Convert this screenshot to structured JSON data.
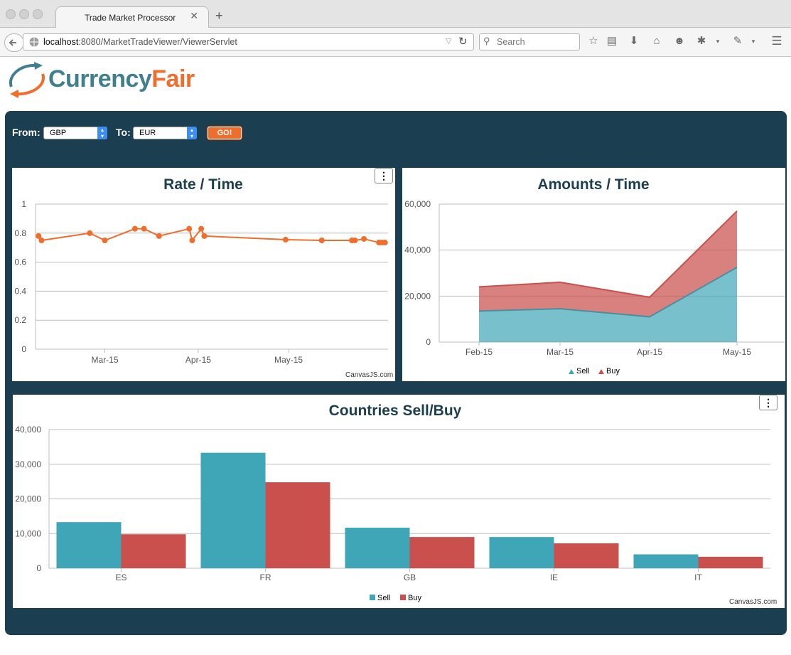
{
  "browser": {
    "tab_title": "Trade Market Processor",
    "url_host": "localhost",
    "url_rest": ":8080/MarketTradeViewer/ViewerServlet",
    "search_placeholder": "Search"
  },
  "logo": {
    "part1": "Currency",
    "part2": "Fair",
    "color1": "#3f7f8f",
    "color2": "#f06d2c"
  },
  "controls": {
    "from_label": "From:",
    "from_value": "GBP",
    "to_label": "To:",
    "to_value": "EUR",
    "go_label": "GO!"
  },
  "credits": "CanvasJS.com",
  "colors": {
    "panel_bg": "#1b3e50",
    "accent": "#f06d2c",
    "sell": "#3fa6b7",
    "buy": "#c9504c"
  },
  "chart_data": [
    {
      "type": "line",
      "title": "Rate / Time",
      "ylim": [
        0,
        1
      ],
      "yticks": [
        "0",
        "0.2",
        "0.4",
        "0.6",
        "0.8",
        "1"
      ],
      "xticks": [
        "Mar-15",
        "Apr-15",
        "May-15"
      ],
      "x": [
        "2015-02-07",
        "2015-02-08",
        "2015-02-24",
        "2015-03-01",
        "2015-03-11",
        "2015-03-14",
        "2015-03-19",
        "2015-03-29",
        "2015-03-30",
        "2015-04-02",
        "2015-04-03",
        "2015-04-30",
        "2015-05-12",
        "2015-05-22",
        "2015-05-23",
        "2015-05-26",
        "2015-05-31",
        "2015-06-01",
        "2015-06-02"
      ],
      "values": [
        0.78,
        0.75,
        0.8,
        0.75,
        0.83,
        0.83,
        0.78,
        0.83,
        0.75,
        0.83,
        0.78,
        0.755,
        0.75,
        0.75,
        0.75,
        0.76,
        0.735,
        0.735,
        0.735
      ],
      "grid": true
    },
    {
      "type": "area",
      "title": "Amounts / Time",
      "categories": [
        "Feb-15",
        "Mar-15",
        "Apr-15",
        "May-15"
      ],
      "ylim": [
        0,
        60000
      ],
      "yticks": [
        "0",
        "20,000",
        "40,000",
        "60,000"
      ],
      "series": [
        {
          "name": "Sell",
          "values": [
            13500,
            14500,
            11000,
            32500
          ]
        },
        {
          "name": "Buy",
          "values": [
            10500,
            11500,
            8500,
            24500
          ]
        }
      ],
      "stacked": true,
      "legend": "bottom",
      "legend_items": [
        "Sell",
        "Buy"
      ]
    },
    {
      "type": "bar",
      "title": "Countries Sell/Buy",
      "categories": [
        "ES",
        "FR",
        "GB",
        "IE",
        "IT"
      ],
      "ylim": [
        0,
        40000
      ],
      "yticks": [
        "0",
        "10,000",
        "20,000",
        "30,000",
        "40,000"
      ],
      "series": [
        {
          "name": "Sell",
          "values": [
            13300,
            33300,
            11700,
            9000,
            4000
          ]
        },
        {
          "name": "Buy",
          "values": [
            9800,
            24800,
            9000,
            7200,
            3300
          ]
        }
      ],
      "legend": "bottom",
      "legend_items": [
        "Sell",
        "Buy"
      ]
    }
  ]
}
